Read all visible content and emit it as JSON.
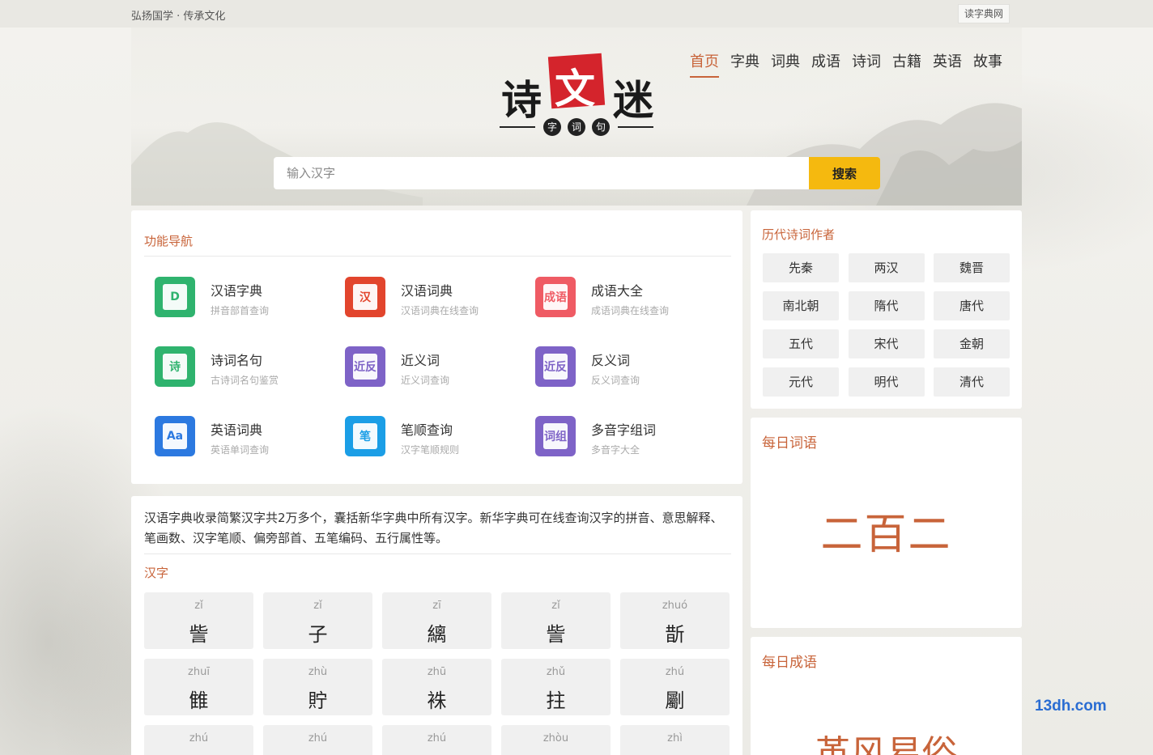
{
  "topbar": {
    "slogan": "弘扬国学 · 传承文化",
    "site_link": "读字典网"
  },
  "logo": {
    "chars": [
      "诗",
      "文",
      "迷"
    ],
    "sub": [
      "字",
      "词",
      "句"
    ]
  },
  "nav": [
    "首页",
    "字典",
    "词典",
    "成语",
    "诗词",
    "古籍",
    "英语",
    "故事"
  ],
  "nav_active": 0,
  "search": {
    "placeholder": "输入汉字",
    "button": "搜索"
  },
  "features": {
    "title": "功能导航",
    "items": [
      {
        "title": "汉语字典",
        "sub": "拼音部首查询",
        "icon": "dictionary-icon",
        "glyph": "D",
        "color": "#2fb36e"
      },
      {
        "title": "汉语词典",
        "sub": "汉语词典在线查询",
        "icon": "word-dictionary-icon",
        "glyph": "汉",
        "color": "#e2452d"
      },
      {
        "title": "成语大全",
        "sub": "成语词典在线查询",
        "icon": "idiom-book-icon",
        "glyph": "成语",
        "color": "#ef5b64"
      },
      {
        "title": "诗词名句",
        "sub": "古诗词名句鉴赏",
        "icon": "poetry-book-icon",
        "glyph": "诗",
        "color": "#2fb36e"
      },
      {
        "title": "近义词",
        "sub": "近义词查询",
        "icon": "synonym-icon",
        "glyph": "近反",
        "color": "#7e63c7"
      },
      {
        "title": "反义词",
        "sub": "反义词查询",
        "icon": "antonym-icon",
        "glyph": "近反",
        "color": "#7e63c7"
      },
      {
        "title": "英语词典",
        "sub": "英语单词查询",
        "icon": "english-dictionary-icon",
        "glyph": "Aa",
        "color": "#2c79e0"
      },
      {
        "title": "笔顺查询",
        "sub": "汉字笔顺规则",
        "icon": "stroke-order-icon",
        "glyph": "笔",
        "color": "#1b9ee6"
      },
      {
        "title": "多音字组词",
        "sub": "多音字大全",
        "icon": "polyphone-icon",
        "glyph": "词组",
        "color": "#7e63c7"
      }
    ]
  },
  "hanzi": {
    "intro": "汉语字典收录简繁汉字共2万多个，囊括新华字典中所有汉字。新华字典可在线查询汉字的拼音、意思解释、笔画数、汉字笔顺、偏旁部首、五笔编码、五行属性等。",
    "title": "汉字",
    "cells": [
      {
        "py": "zǐ",
        "zi": "訾"
      },
      {
        "py": "zǐ",
        "zi": "子"
      },
      {
        "py": "zī",
        "zi": "縭"
      },
      {
        "py": "zǐ",
        "zi": "訾"
      },
      {
        "py": "zhuó",
        "zi": "斮"
      },
      {
        "py": "zhuī",
        "zi": "雔"
      },
      {
        "py": "zhù",
        "zi": "貯"
      },
      {
        "py": "zhū",
        "zi": "袾"
      },
      {
        "py": "zhǔ",
        "zi": "拄"
      },
      {
        "py": "zhú",
        "zi": "劚"
      },
      {
        "py": "zhú",
        "zi": ""
      },
      {
        "py": "zhú",
        "zi": ""
      },
      {
        "py": "zhú",
        "zi": ""
      },
      {
        "py": "zhòu",
        "zi": ""
      },
      {
        "py": "zhì",
        "zi": ""
      }
    ]
  },
  "authors": {
    "title": "历代诗词作者",
    "eras": [
      "先秦",
      "两汉",
      "魏晋",
      "南北朝",
      "隋代",
      "唐代",
      "五代",
      "宋代",
      "金朝",
      "元代",
      "明代",
      "清代"
    ]
  },
  "daily_word": {
    "title": "每日词语",
    "word": "二百二"
  },
  "daily_idiom": {
    "title": "每日成语",
    "idiom": "革风易俗"
  },
  "watermark": "13dh.com",
  "colors": {
    "accent": "#c8643a",
    "search_button": "#f5b90f"
  }
}
